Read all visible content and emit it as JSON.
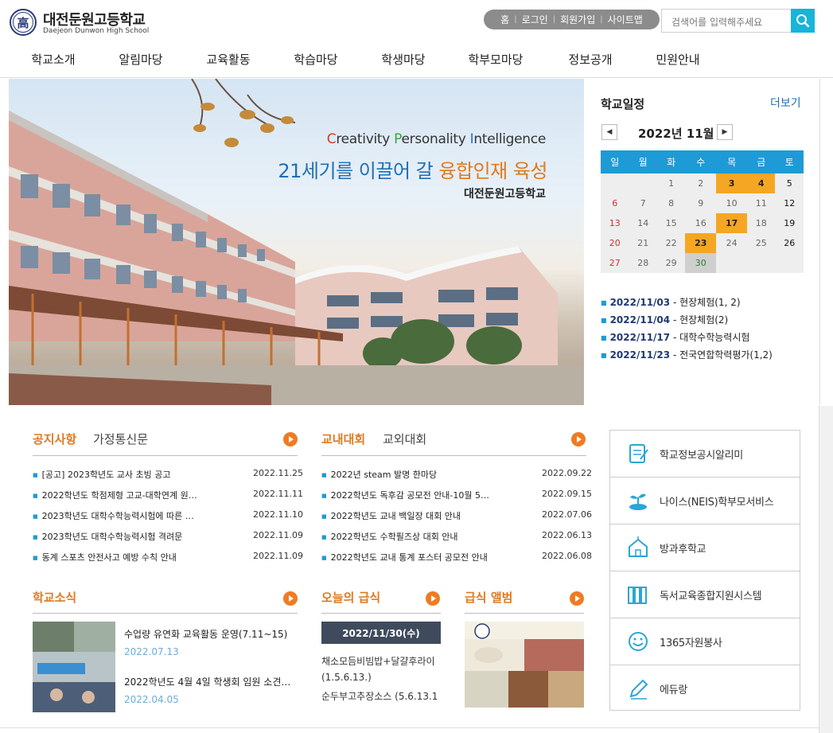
{
  "header": {
    "logo_char": "高",
    "school_name": "대전둔원고등학교",
    "school_name_en": "Daejeon Dunwon High School",
    "util": [
      "홈",
      "로그인",
      "회원가입",
      "사이트맵"
    ],
    "search_placeholder": "검색어를 입력해주세요"
  },
  "gnb": [
    "학교소개",
    "알림마당",
    "교육활동",
    "학습마당",
    "학생마당",
    "학부모마당",
    "정보공개",
    "민원안내"
  ],
  "banner": {
    "sub_letters": [
      "C",
      "reativity ",
      "P",
      "ersonality ",
      "I",
      "ntelligence"
    ],
    "main_prefix": "21세기를 이끌어 갈 ",
    "main_highlight": "융합인재 육성",
    "school": "대전둔원고등학교"
  },
  "calendar": {
    "title": "학교일정",
    "more": "더보기",
    "prev": "◀",
    "next": "▶",
    "month": "2022년 11월",
    "weekdays": [
      "일",
      "월",
      "화",
      "수",
      "목",
      "금",
      "토"
    ],
    "weeks": [
      [
        "",
        "",
        "1",
        "2",
        "3",
        "4",
        "5"
      ],
      [
        "6",
        "7",
        "8",
        "9",
        "10",
        "11",
        "12"
      ],
      [
        "13",
        "14",
        "15",
        "16",
        "17",
        "18",
        "19"
      ],
      [
        "20",
        "21",
        "22",
        "23",
        "24",
        "25",
        "26"
      ],
      [
        "27",
        "28",
        "29",
        "30",
        "",
        "",
        ""
      ]
    ],
    "event_days": [
      "3",
      "4",
      "17",
      "23"
    ],
    "today": "30",
    "events": [
      {
        "date": "2022/11/03",
        "text": " - 현장체험(1, 2)"
      },
      {
        "date": "2022/11/04",
        "text": " - 현장체험(2)"
      },
      {
        "date": "2022/11/17",
        "text": " - 대학수학능력시험"
      },
      {
        "date": "2022/11/23",
        "text": " - 전국연합학력평가(1,2)"
      }
    ],
    "colors": {
      "event": "#f5a623",
      "header": "#1e9ad6"
    }
  },
  "notice": {
    "tab_active": "공지사항",
    "tab_other": "가정통신문",
    "items": [
      {
        "title": "[공고] 2023학년도 교사 초빙 공고",
        "date": "2022.11.25"
      },
      {
        "title": "2022학년도 학점제형 고교-대학연계 원…",
        "date": "2022.11.11"
      },
      {
        "title": "2023학년도 대학수학능력시험에 따른 …",
        "date": "2022.11.10"
      },
      {
        "title": "2023학년도 대학수학능력시험 격려문",
        "date": "2022.11.09"
      },
      {
        "title": "동계 스포츠 안전사고 예방 수칙 안내",
        "date": "2022.11.09"
      }
    ]
  },
  "contest": {
    "tab_active": "교내대회",
    "tab_other": "교외대회",
    "items": [
      {
        "title": "2022년 steam 발명 한마당",
        "date": "2022.09.22"
      },
      {
        "title": "2022학년도 독후감 공모전 안내-10월 5…",
        "date": "2022.09.15"
      },
      {
        "title": "2022학년도 교내 백일장 대회 안내",
        "date": "2022.07.06"
      },
      {
        "title": "2022학년도 수학필즈상 대회 안내",
        "date": "2022.06.13"
      },
      {
        "title": "2022학년도 교내 통계 포스터 공모전 안내",
        "date": "2022.06.08"
      }
    ]
  },
  "news": {
    "title": "학교소식",
    "items": [
      {
        "title": "수업량 유연화 교육활동 운영(7.11~15)",
        "date": "2022.07.13"
      },
      {
        "title": "2022학년도 4월 4일 학생회 임원 소견…",
        "date": "2022.04.05"
      }
    ]
  },
  "meal": {
    "title": "오늘의 급식",
    "date": "2022/11/30(수)",
    "lines": [
      "채소모듬비빔밥+달걀후라이",
      "(1.5.6.13.)",
      "순두부고추장소스 (5.6.13.1"
    ]
  },
  "album": {
    "title": "급식 앨범"
  },
  "quick": [
    {
      "icon": "notepad-icon",
      "label": "학교정보공시알리미"
    },
    {
      "icon": "sprout-icon",
      "label": "나이스(NEIS)학부모서비스"
    },
    {
      "icon": "school-building-icon",
      "label": "방과후학교"
    },
    {
      "icon": "books-icon",
      "label": "독서교육종합지원시스템"
    },
    {
      "icon": "smile-icon",
      "label": "1365자원봉사"
    },
    {
      "icon": "pencil-icon",
      "label": "에듀랑"
    }
  ]
}
